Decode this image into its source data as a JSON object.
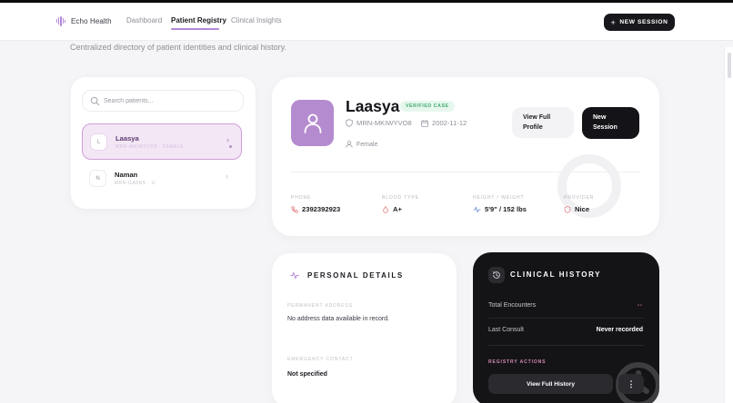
{
  "app": {
    "brand": "Echo Health",
    "accent": "#b487d6"
  },
  "nav": {
    "links": [
      "Dashboard",
      "Patient Registry",
      "Clinical Insights"
    ],
    "active": "Patient Registry",
    "new_session_label": "NEW SESSION"
  },
  "page": {
    "subtitle": "Centralized directory of patient identities and clinical history."
  },
  "search": {
    "placeholder": "Search patients...",
    "value": ""
  },
  "patients": [
    {
      "initial": "L",
      "name": "Laasya",
      "meta": "MRN-MKIWYVO8 · FEMALE",
      "selected": true
    },
    {
      "initial": "N",
      "name": "Naman",
      "meta": "MRN-GA6NS · U",
      "selected": false
    }
  ],
  "profile": {
    "name": "Laasya",
    "badge": "VERIFIED CASE",
    "mrn": "MRN-MKIWYVO8",
    "dob": "2002-11-12",
    "gender": "Female",
    "view_profile_label": "View Full Profile",
    "new_session_label": "New Session",
    "stats": [
      {
        "label": "PHONE",
        "value": "2392392923",
        "icon": "phone-icon"
      },
      {
        "label": "BLOOD TYPE",
        "value": "A+",
        "icon": "blood-drop-icon"
      },
      {
        "label": "HEIGHT / WEIGHT",
        "value": "5'9\" / 152 lbs",
        "icon": "activity-icon"
      },
      {
        "label": "PROVIDER",
        "value": "Nice",
        "icon": "shield-icon"
      }
    ]
  },
  "personal": {
    "title": "PERSONAL DETAILS",
    "address_label": "PERMANENT ADDRESS",
    "address_value": "No address data available in record.",
    "emergency_label": "EMERGENCY CONTACT",
    "emergency_value": "Not specified"
  },
  "clinical": {
    "title": "CLINICAL HISTORY",
    "encounters_label": "Total Encounters",
    "encounters_value": "--",
    "last_consult_label": "Last Consult",
    "last_consult_value": "Never recorded",
    "actions_label": "REGISTRY ACTIONS",
    "history_button": "View Full History",
    "more_button": "⋮"
  }
}
